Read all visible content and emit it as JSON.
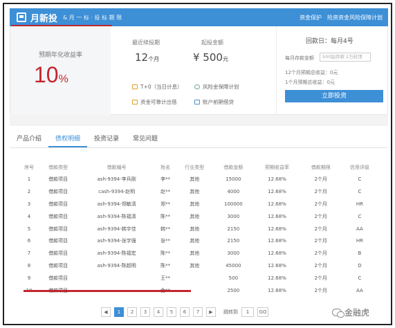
{
  "header": {
    "brand": "月新投",
    "subtitle": "& 月 一 标  · 投 标 期 限",
    "link_protect": "资金保护",
    "link_insurance": "险资资金风险保障计划"
  },
  "summary": {
    "rate_label": "预期年化收益率",
    "rate_value": "10",
    "rate_unit": "%",
    "term_label": "最近续投期",
    "term_value": "12",
    "term_unit": "个月",
    "start_label": "起投金额",
    "start_value": "¥ 500",
    "start_unit": "元",
    "features": [
      "T+0（当日计息）",
      "风险金保障计划",
      "资金可靠计出借",
      "账户前期借贷"
    ],
    "repay_label": "回款日：每月4号",
    "monthly_label": "每月存款金额",
    "monthly_placeholder": "500起存款  2万封顶",
    "income12": "12个月预期总收益：0元",
    "income1": "1个月预期总收益：0元",
    "invest_button": "立即投资"
  },
  "tabs": [
    {
      "label": "产品介绍"
    },
    {
      "label": "债权明细"
    },
    {
      "label": "投资记录"
    },
    {
      "label": "常见问题"
    }
  ],
  "table": {
    "headers": [
      "序号",
      "借款类型",
      "借款编号",
      "姓名",
      "行业类型",
      "借款金额",
      "预期收益率",
      "借款期限",
      "信用评级"
    ],
    "rows": [
      [
        "1",
        "借款项目",
        "ash-9394-李兵刚",
        "李**",
        "其他",
        "15000",
        "12.68%",
        "2个月",
        "C"
      ],
      [
        "2",
        "借款项目",
        "cash-9394-赵明",
        "赵**",
        "其他",
        "4000",
        "12.68%",
        "2个月",
        "C"
      ],
      [
        "3",
        "借款项目",
        "ash-9394-郑敏清",
        "郑**",
        "其他",
        "100000",
        "12.68%",
        "2个月",
        "HR"
      ],
      [
        "4",
        "借款项目",
        "ash-9394-陈福清",
        "陈**",
        "其他",
        "3000",
        "12.68%",
        "2个月",
        "C"
      ],
      [
        "5",
        "借款项目",
        "ash-9394-韩宇佳",
        "韩**",
        "其他",
        "2150",
        "12.68%",
        "2个月",
        "AA"
      ],
      [
        "6",
        "借款项目",
        "ash-9394-张宇强",
        "张**",
        "其他",
        "2150",
        "12.68%",
        "2个月",
        "HR"
      ],
      [
        "7",
        "借款项目",
        "ash-9394-陈福宏",
        "陈**",
        "其他",
        "3000",
        "12.68%",
        "2个月",
        "B"
      ],
      [
        "8",
        "借款项目",
        "ash-9394-陈超明",
        "陈**",
        "其他",
        "45000",
        "12.68%",
        "2个月",
        "D"
      ],
      [
        "9",
        "借款项目",
        "",
        "王**",
        "",
        "500",
        "12.68%",
        "2个月",
        "C"
      ],
      [
        "10",
        "借款项目",
        "",
        "金**",
        "",
        "2500",
        "12.68%",
        "2个月",
        "AA"
      ]
    ]
  },
  "pager": {
    "prev": "◀",
    "pages": [
      "1",
      "2",
      "3",
      "4",
      "5",
      "6",
      "7"
    ],
    "current": "1",
    "next": "▶",
    "goto_label": "跳转到",
    "goto_value": "1",
    "go_label": "GO"
  },
  "watermark": "金融虎",
  "colors": {
    "accent": "#3d8fd6",
    "rate": "#c2262d",
    "underline": "#c2262d"
  }
}
